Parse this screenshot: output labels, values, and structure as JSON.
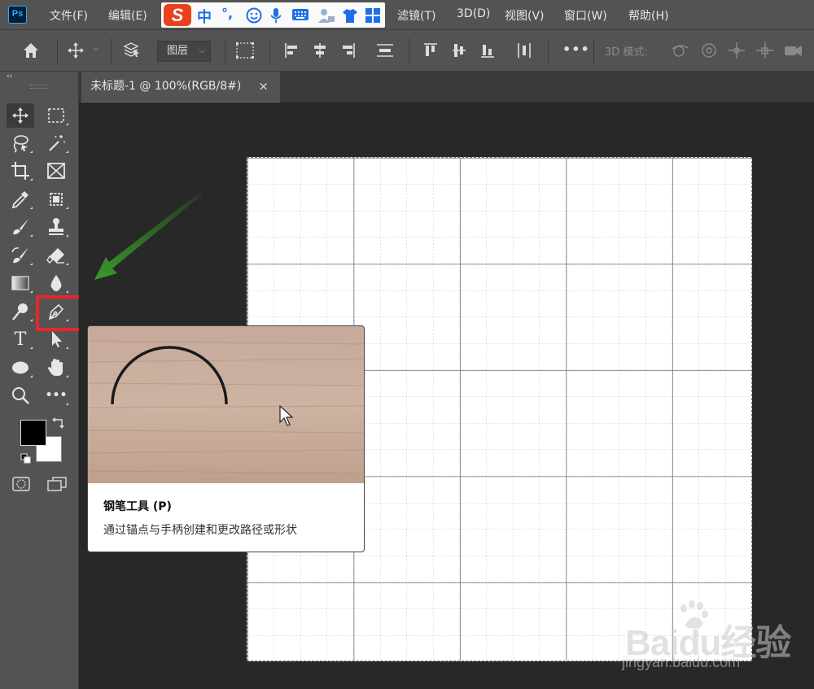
{
  "menubar": {
    "app_logo": "Ps",
    "items": [
      "文件(F)",
      "编辑(E)",
      "滤镜(T)",
      "3D(D)",
      "视图(V)",
      "窗口(W)",
      "帮助(H)"
    ],
    "ime": {
      "logo": "S",
      "lang": "中",
      "punct": "°,"
    }
  },
  "optbar": {
    "layer_dropdown": "图层",
    "mode_3d_label": "3D 模式:"
  },
  "toolbar": {
    "collapse": "‹‹",
    "tools": [
      {
        "name": "move-tool",
        "icon": "move-icon",
        "active": true
      },
      {
        "name": "marquee-tool",
        "icon": "marquee-icon"
      },
      {
        "name": "lasso-tool",
        "icon": "lasso-icon"
      },
      {
        "name": "magic-wand-tool",
        "icon": "magic-wand-icon"
      },
      {
        "name": "crop-tool",
        "icon": "crop-icon"
      },
      {
        "name": "frame-tool",
        "icon": "frame-icon"
      },
      {
        "name": "eyedropper-tool",
        "icon": "eyedropper-icon"
      },
      {
        "name": "healing-brush-tool",
        "icon": "healing-brush-icon"
      },
      {
        "name": "brush-tool",
        "icon": "brush-icon"
      },
      {
        "name": "stamp-tool",
        "icon": "stamp-icon"
      },
      {
        "name": "history-brush-tool",
        "icon": "history-brush-icon"
      },
      {
        "name": "eraser-tool",
        "icon": "eraser-icon"
      },
      {
        "name": "gradient-tool",
        "icon": "gradient-icon"
      },
      {
        "name": "blur-tool",
        "icon": "blur-icon"
      },
      {
        "name": "dodge-tool",
        "icon": "dodge-icon"
      },
      {
        "name": "pen-tool",
        "icon": "pen-icon",
        "highlighted": true
      },
      {
        "name": "type-tool",
        "icon": "type-icon",
        "glyph": "T"
      },
      {
        "name": "path-selection-tool",
        "icon": "path-selection-icon"
      },
      {
        "name": "ellipse-tool",
        "icon": "ellipse-icon"
      },
      {
        "name": "hand-tool",
        "icon": "hand-icon"
      },
      {
        "name": "zoom-tool",
        "icon": "zoom-icon"
      },
      {
        "name": "more-tools",
        "icon": "more-icon",
        "glyph": "•••"
      }
    ],
    "foreground_color": "#000000",
    "background_color": "#ffffff",
    "highlight_color": "#e8262b"
  },
  "document": {
    "tab_title": "未标题-1 @ 100%(RGB/8#)",
    "tab_close": "×"
  },
  "tooltip": {
    "title": "钢笔工具 (P)",
    "description": "通过锚点与手柄创建和更改路径或形状"
  },
  "annotation": {
    "arrow_color": "#3a9a2b"
  },
  "watermark": {
    "brand": "Baidu经验",
    "url": "jingyan.baidu.com"
  }
}
